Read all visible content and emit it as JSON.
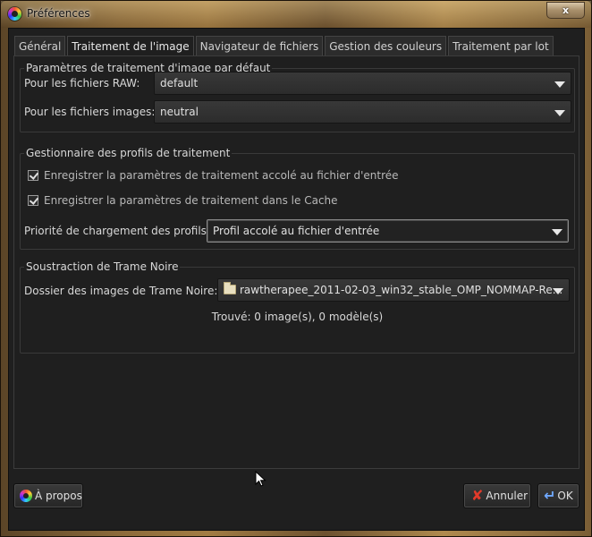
{
  "window": {
    "title": "Préférences",
    "close_glyph": "x"
  },
  "tabs": [
    {
      "label": "Général"
    },
    {
      "label": "Traitement de l'image"
    },
    {
      "label": "Navigateur de fichiers"
    },
    {
      "label": "Gestion des couleurs"
    },
    {
      "label": "Traitement par lot"
    }
  ],
  "defaults_group": {
    "title": "Paramètres de traitement d'image par défaut",
    "raw_label": "Pour les fichiers RAW:",
    "raw_value": "default",
    "img_label": "Pour les fichiers images:",
    "img_value": "neutral"
  },
  "profiles_group": {
    "title": "Gestionnaire des profils de traitement",
    "check1": "Enregistrer la paramètres de traitement accolé au fichier d'entrée",
    "check1_checked": true,
    "check2": "Enregistrer la paramètres de traitement dans le Cache",
    "check2_checked": true,
    "priority_label": "Priorité de chargement des profils:",
    "priority_value": "Profil accolé au fichier d'entrée"
  },
  "darkframe_group": {
    "title": "Soustraction de Trame Noire",
    "folder_label": "Dossier des images de Trame Noire:",
    "folder_value": "rawtherapee_2011-02-03_win32_stable_OMP_NOMMAP-Re...",
    "found_text": "Trouvé: 0 image(s), 0 modèle(s)"
  },
  "buttons": {
    "about": "À propos",
    "cancel": "Annuler",
    "ok": "OK"
  },
  "colors": {
    "accent_cancel": "#e23a2a",
    "accent_ok": "#6fa8ff"
  }
}
